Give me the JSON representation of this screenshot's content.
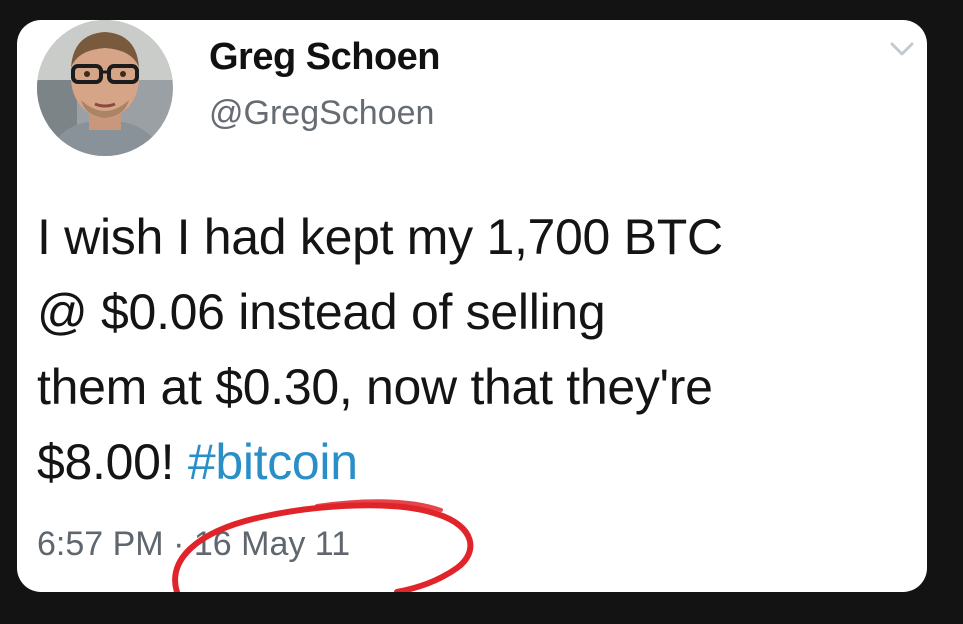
{
  "tweet": {
    "author": {
      "display_name": "Greg Schoen",
      "handle": "@GregSchoen"
    },
    "text_lines": [
      "I wish I had kept my 1,700 BTC",
      "@ $0.06 instead of selling",
      "them at $0.30, now that they're"
    ],
    "last_line_prefix": "$8.00! ",
    "hashtag": "#bitcoin",
    "time": "6:57 PM",
    "separator": "·",
    "date": "16 May 11"
  },
  "icons": {
    "menu": "chevron-down-icon",
    "avatar": "profile-photo"
  },
  "colors": {
    "background": "#131313",
    "card": "#ffffff",
    "hashtag": "#2b8fc7",
    "annotation_circle": "#e0242a"
  }
}
